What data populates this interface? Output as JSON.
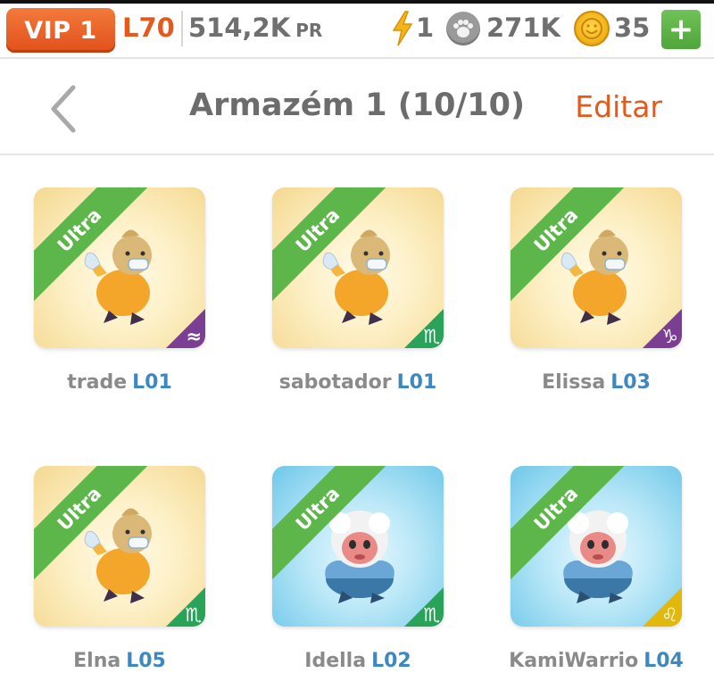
{
  "topbar": {
    "vip": "VIP 1",
    "level": "L70",
    "power": "514,2K",
    "power_unit": "PR",
    "energy": "1",
    "paws": "271K",
    "coins": "35",
    "add_label": "+"
  },
  "header": {
    "title": "Armazém 1 (10/10)",
    "edit_label": "Editar"
  },
  "pets": [
    {
      "rarity": "Ultra",
      "name": "trade",
      "level": "L01",
      "zodiac": "≈",
      "zodiac_color": "#7a3e93",
      "bg": "yellow",
      "creature": "bird-icon"
    },
    {
      "rarity": "Ultra",
      "name": "sabotador",
      "level": "L01",
      "zodiac": "♏",
      "zodiac_color": "#2aa35a",
      "bg": "yellow",
      "creature": "bird-icon"
    },
    {
      "rarity": "Ultra",
      "name": "Elissa",
      "level": "L03",
      "zodiac": "♑",
      "zodiac_color": "#7a3e93",
      "bg": "yellow",
      "creature": "bird-icon"
    },
    {
      "rarity": "Ultra",
      "name": "Elna",
      "level": "L05",
      "zodiac": "♏",
      "zodiac_color": "#2aa35a",
      "bg": "yellow",
      "creature": "bird-icon"
    },
    {
      "rarity": "Ultra",
      "name": "Idella",
      "level": "L02",
      "zodiac": "♏",
      "zodiac_color": "#2aa35a",
      "bg": "blue",
      "creature": "yeti-icon"
    },
    {
      "rarity": "Ultra",
      "name": "KamiWarrio",
      "level": "L04",
      "zodiac": "♌",
      "zodiac_color": "#e2b80f",
      "bg": "blue",
      "creature": "yeti-icon"
    }
  ]
}
